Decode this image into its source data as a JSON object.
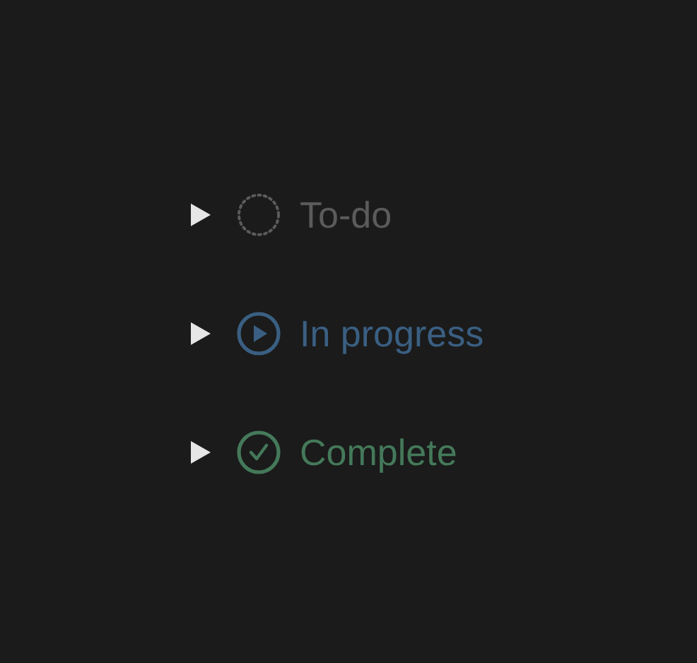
{
  "groups": [
    {
      "kind": "todo",
      "label": "To-do",
      "color": "#5b5b5b",
      "expanded": false
    },
    {
      "kind": "progress",
      "label": "In progress",
      "color": "#3a5f82",
      "expanded": false
    },
    {
      "kind": "complete",
      "label": "Complete",
      "color": "#44795a",
      "expanded": false
    }
  ]
}
